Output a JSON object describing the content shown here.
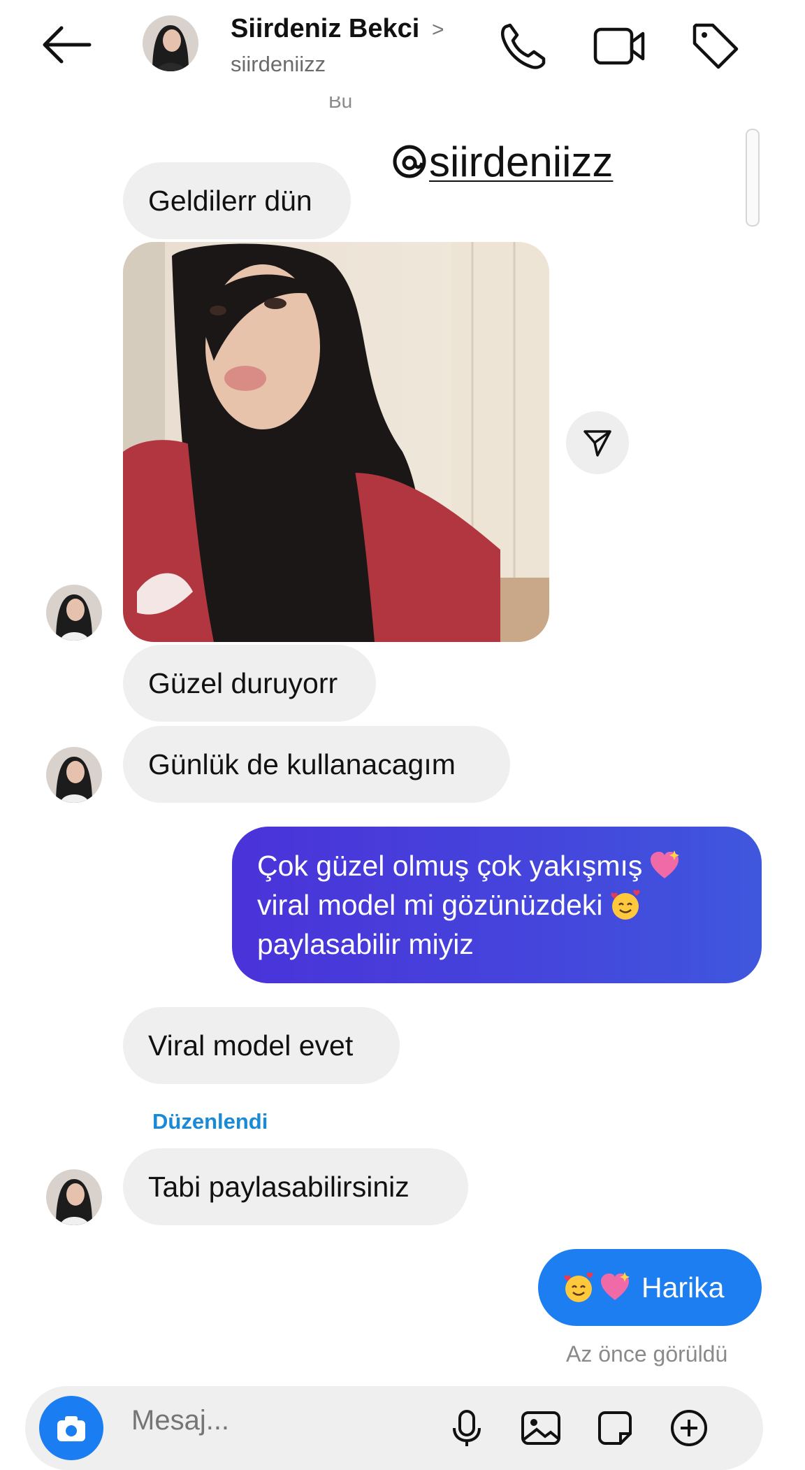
{
  "header": {
    "back_icon": "arrow-left-icon",
    "contact_name": "Siirdeniz Bekci",
    "chevron": ">",
    "username": "siirdeniizz",
    "actions": [
      "phone-icon",
      "video-camera-icon",
      "tag-icon"
    ]
  },
  "partial_top_text": "Bu",
  "watermark": {
    "handle": "siirdeniizz",
    "logo": "threads-logo"
  },
  "messages": {
    "m1": "Geldilerr dün",
    "m2": "Güzel duruyorr",
    "m3": "Günlük de kullanacagım",
    "m4": {
      "line1": "Çok güzel olmuş çok yakışmış",
      "line2": "viral model mi gözünüzdeki",
      "line3": "paylasabilir miyiz"
    },
    "m5": "Viral model evet",
    "edited_label": "Düzenlendi",
    "m6": "Tabi paylasabilirsiniz",
    "m7": "Harika"
  },
  "seen_status": "Az önce görüldü",
  "composer": {
    "placeholder": "Mesaj...",
    "icons": [
      "camera-icon",
      "microphone-icon",
      "gallery-icon",
      "sticker-icon",
      "plus-icon"
    ]
  },
  "colors": {
    "outgoing_purple": "#4a3fdb",
    "outgoing_blue": "#1c7ef0",
    "incoming_gray": "#efefef",
    "edited_blue": "#1a8ad6"
  }
}
